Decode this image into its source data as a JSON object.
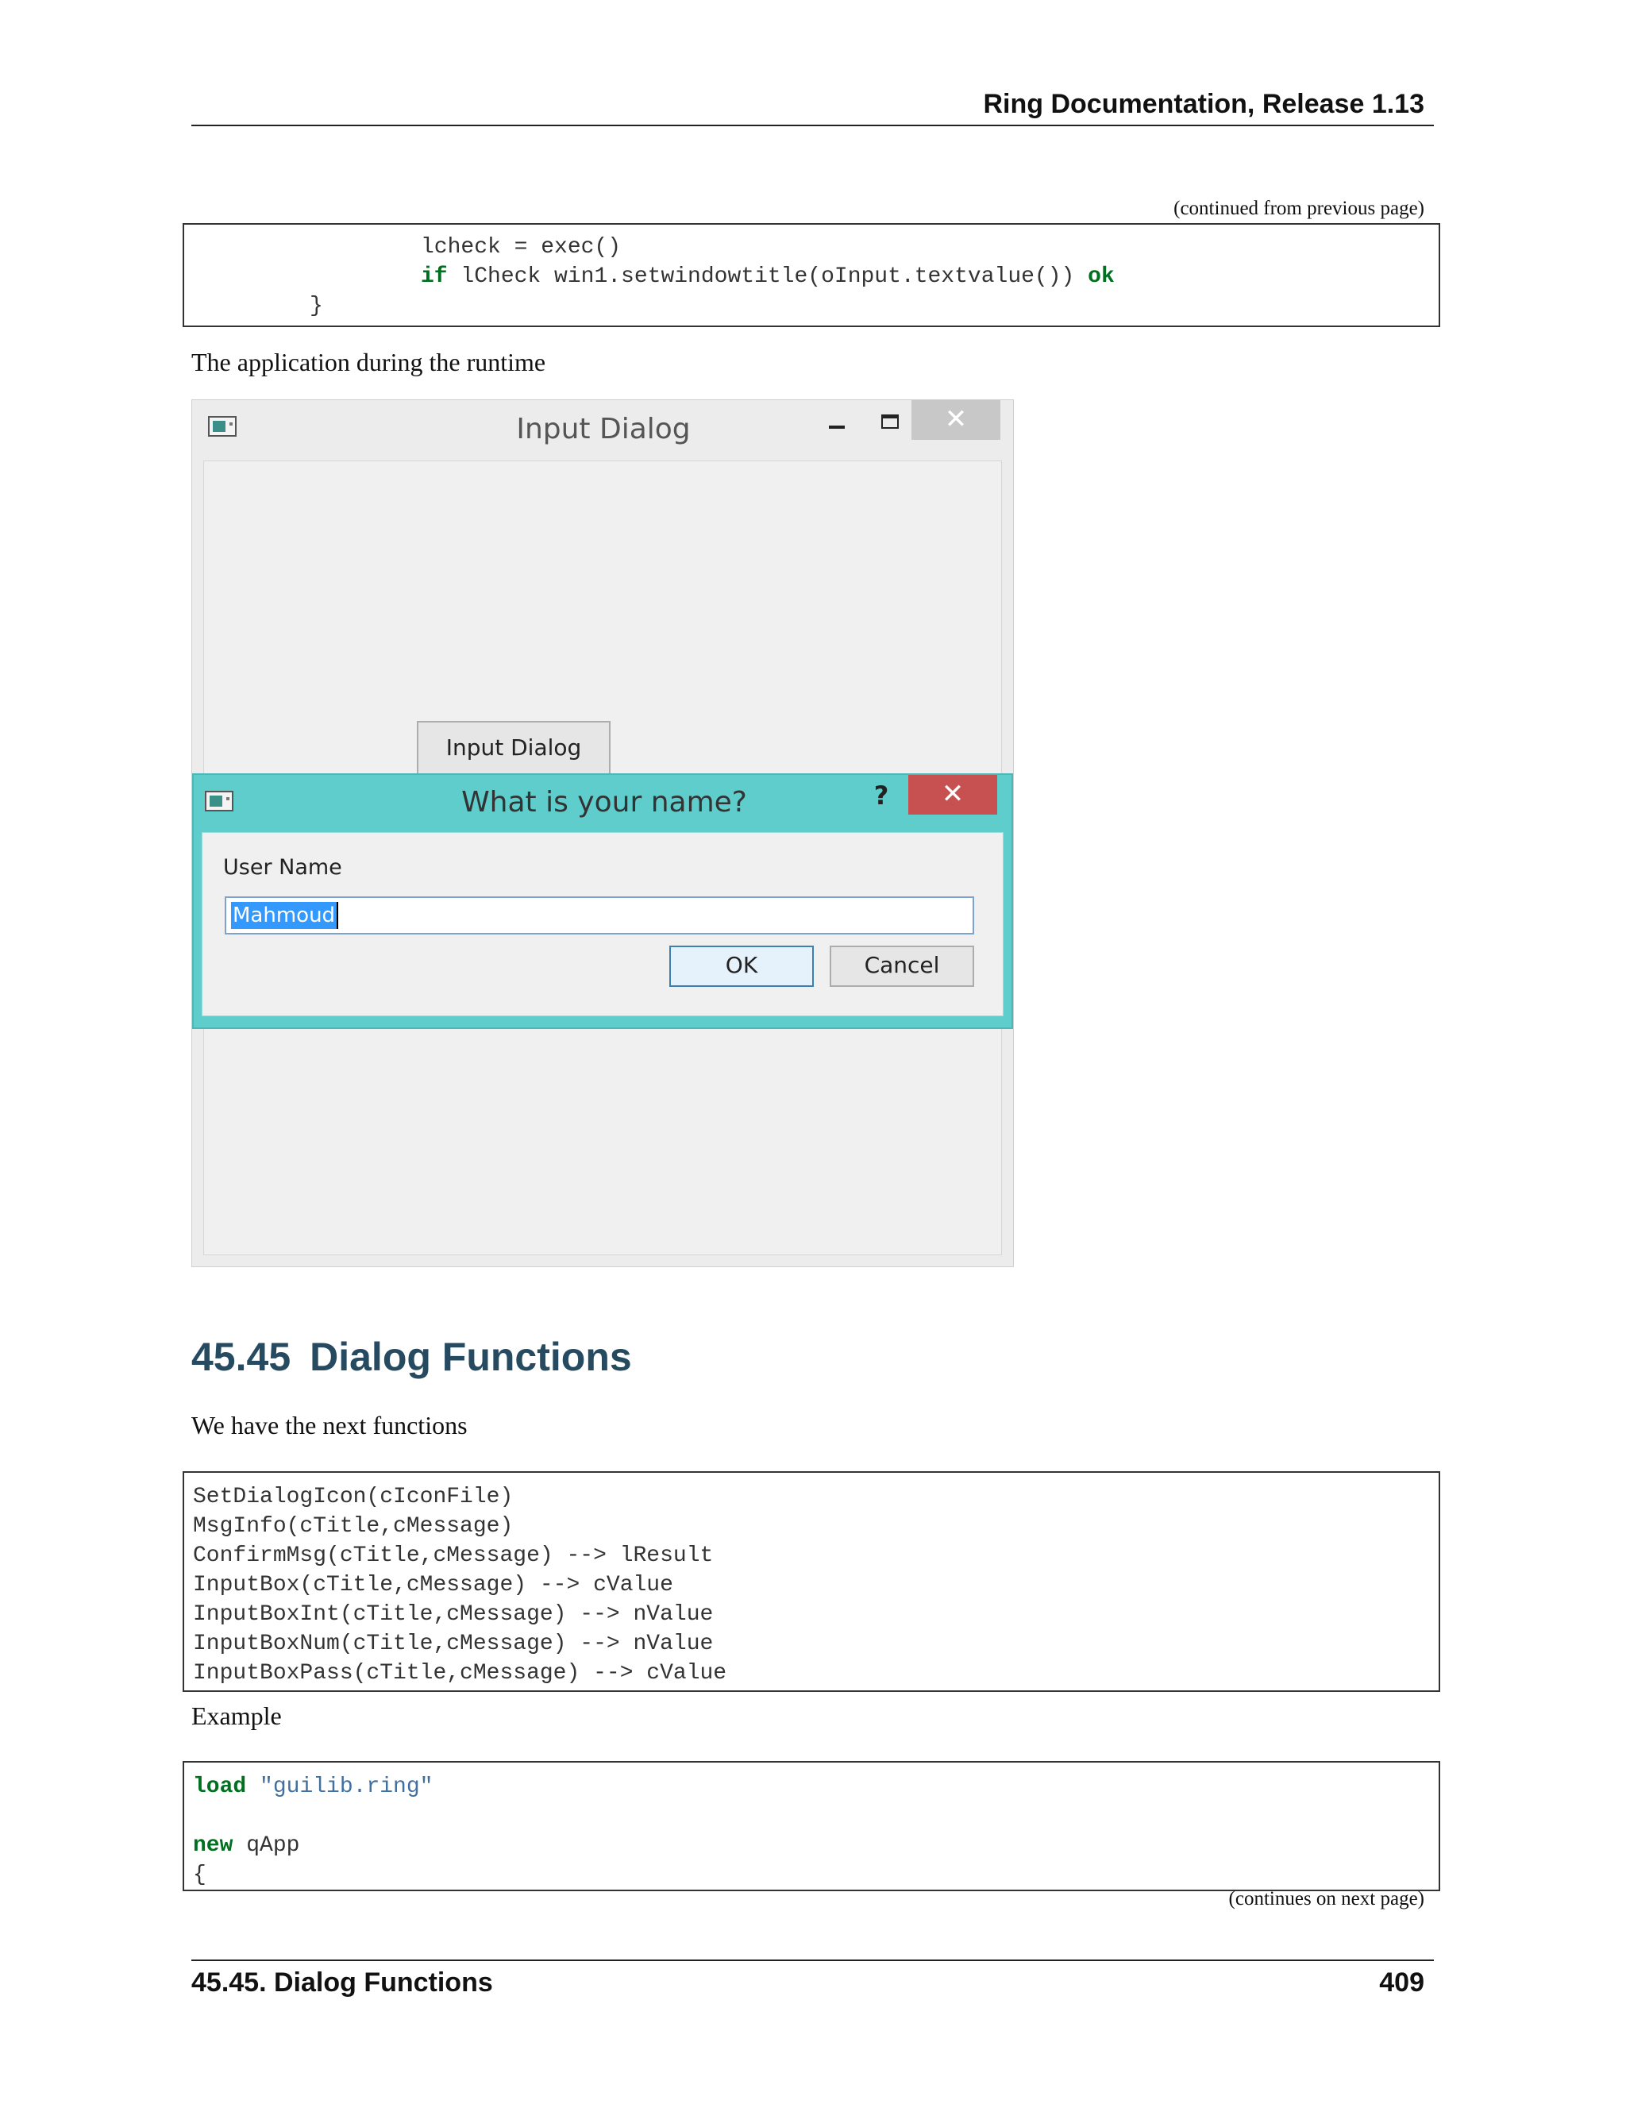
{
  "header": {
    "title": "Ring Documentation, Release 1.13"
  },
  "continued_from": "(continued from previous page)",
  "code_top": {
    "line1": "lcheck = exec()",
    "line2_kw_if": "if",
    "line2_body": " lCheck win1.setwindowtitle(oInput.textvalue()) ",
    "line2_kw_ok": "ok",
    "line3": "}"
  },
  "runtime_caption": "The application during the runtime",
  "screenshot": {
    "main_window": {
      "title": "Input Dialog",
      "close_glyph": "✕",
      "button_label": "Input Dialog"
    },
    "dialog": {
      "title": "What is your name?",
      "help_glyph": "?",
      "close_glyph": "✕",
      "field_label": "User Name",
      "field_value": "Mahmoud",
      "ok_label": "OK",
      "cancel_label": "Cancel"
    },
    "icons": [
      "app-window-icon",
      "minimize-icon",
      "maximize-icon",
      "close-icon",
      "help-icon"
    ],
    "colors": {
      "dialog_frame": "#5ecdcc",
      "close_button": "#c75050",
      "selection": "#3399ff"
    }
  },
  "section": {
    "number": "45.45",
    "title": "Dialog Functions"
  },
  "intro_text": "We have the next functions",
  "functions_code": [
    "SetDialogIcon(cIconFile)",
    "MsgInfo(cTitle,cMessage)",
    "ConfirmMsg(cTitle,cMessage) --> lResult",
    "InputBox(cTitle,cMessage) --> cValue",
    "InputBoxInt(cTitle,cMessage) --> nValue",
    "InputBoxNum(cTitle,cMessage) --> nValue",
    "InputBoxPass(cTitle,cMessage) --> cValue"
  ],
  "example_label": "Example",
  "example_code": {
    "line1_kw": "load",
    "line1_str": "\"guilib.ring\"",
    "line3_kw": "new",
    "line3_body": " qApp",
    "line4": "{"
  },
  "continues_next": "(continues on next page)",
  "footer": {
    "section": "45.45.  Dialog Functions",
    "page": "409"
  }
}
